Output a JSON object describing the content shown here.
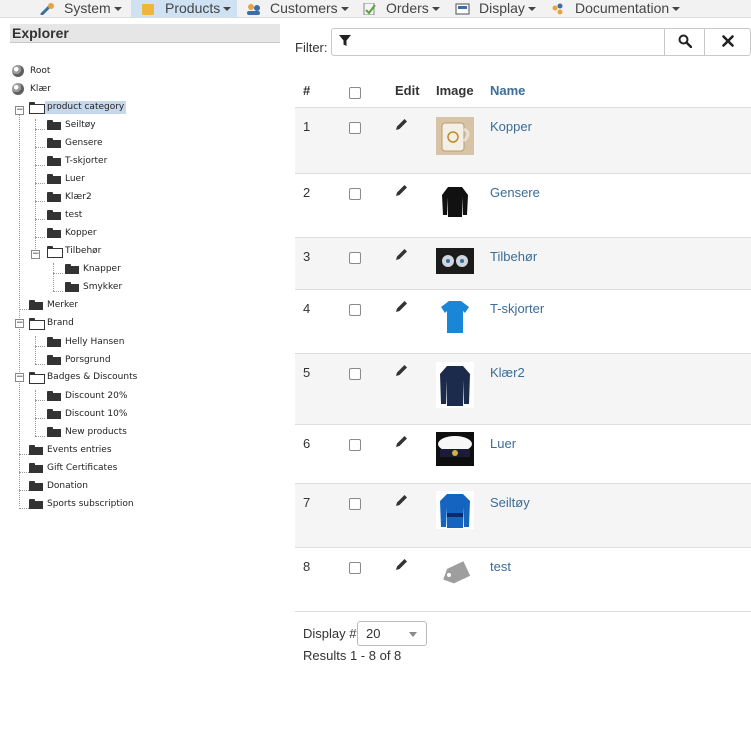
{
  "menu": [
    {
      "label": "System",
      "icon": "wrench-icon",
      "active": false
    },
    {
      "label": "Products",
      "icon": "box-icon",
      "active": true
    },
    {
      "label": "Customers",
      "icon": "users-icon",
      "active": false
    },
    {
      "label": "Orders",
      "icon": "orders-icon",
      "active": false
    },
    {
      "label": "Display",
      "icon": "display-icon",
      "active": false
    },
    {
      "label": "Documentation",
      "icon": "help-icon",
      "active": false
    }
  ],
  "explorer": {
    "title": "Explorer",
    "items": [
      {
        "label": "Root",
        "icon": "globe-icon"
      },
      {
        "label": "Klær",
        "icon": "globe-icon"
      },
      {
        "label": "product category",
        "icon": "folder-open-icon",
        "selected": true
      },
      {
        "label": "Seiltøy",
        "icon": "folder-icon"
      },
      {
        "label": "Gensere",
        "icon": "folder-icon"
      },
      {
        "label": "T-skjorter",
        "icon": "folder-icon"
      },
      {
        "label": "Luer",
        "icon": "folder-icon"
      },
      {
        "label": "Klær2",
        "icon": "folder-icon"
      },
      {
        "label": "test",
        "icon": "folder-icon"
      },
      {
        "label": "Kopper",
        "icon": "folder-icon"
      },
      {
        "label": "Tilbehør",
        "icon": "folder-open-icon"
      },
      {
        "label": "Knapper",
        "icon": "folder-icon"
      },
      {
        "label": "Smykker",
        "icon": "folder-icon"
      },
      {
        "label": "Merker",
        "icon": "folder-icon"
      },
      {
        "label": "Brand",
        "icon": "folder-open-icon"
      },
      {
        "label": "Helly Hansen",
        "icon": "folder-icon"
      },
      {
        "label": "Porsgrund",
        "icon": "folder-icon"
      },
      {
        "label": "Badges & Discounts",
        "icon": "folder-open-icon"
      },
      {
        "label": "Discount 20%",
        "icon": "folder-icon"
      },
      {
        "label": "Discount 10%",
        "icon": "folder-icon"
      },
      {
        "label": "New products",
        "icon": "folder-icon"
      },
      {
        "label": "Events entries",
        "icon": "folder-icon"
      },
      {
        "label": "Gift Certificates",
        "icon": "folder-icon"
      },
      {
        "label": "Donation",
        "icon": "folder-icon"
      },
      {
        "label": "Sports subscription",
        "icon": "folder-icon"
      }
    ]
  },
  "filter": {
    "label": "Filter:",
    "value": "",
    "placeholder": "",
    "filter_icon": "funnel-icon",
    "search_icon": "search-icon",
    "clear_icon": "close-icon"
  },
  "table": {
    "headers": {
      "num": "#",
      "edit": "Edit",
      "image": "Image",
      "name": "Name"
    },
    "rows": [
      {
        "num": "1",
        "name": "Kopper",
        "image": "mug-thumbnail"
      },
      {
        "num": "2",
        "name": "Gensere",
        "image": "sweater-thumbnail"
      },
      {
        "num": "3",
        "name": "Tilbehør",
        "image": "accessories-thumbnail"
      },
      {
        "num": "4",
        "name": "T-skjorter",
        "image": "tshirt-thumbnail"
      },
      {
        "num": "5",
        "name": "Klær2",
        "image": "jacket-thumbnail"
      },
      {
        "num": "6",
        "name": "Luer",
        "image": "cap-thumbnail"
      },
      {
        "num": "7",
        "name": "Seiltøy",
        "image": "sailing-jacket-thumbnail"
      },
      {
        "num": "8",
        "name": "test",
        "image": "tag-thumbnail"
      }
    ]
  },
  "footer": {
    "display_label": "Display #",
    "display_value": "20",
    "results": "Results 1 - 8 of 8"
  },
  "colors": {
    "link": "#3a6d99",
    "active_menu": "#cfe2f3",
    "row_alt": "#f5f5f5",
    "tree_selected": "#c8d8ec"
  }
}
